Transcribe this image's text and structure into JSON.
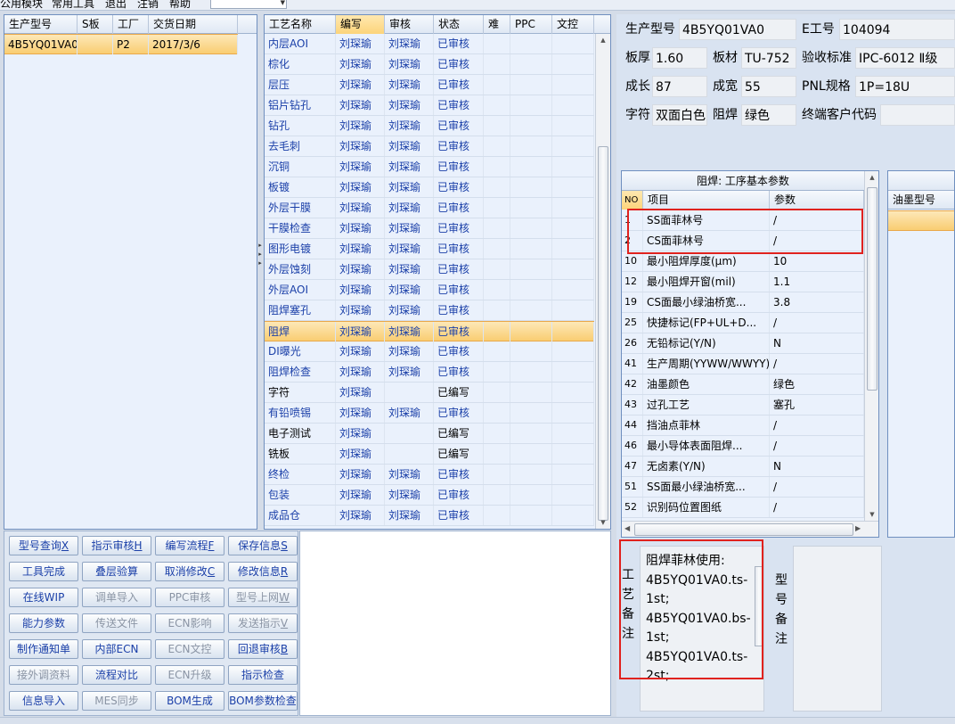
{
  "menu": {
    "items": [
      "公用模块",
      "常用工具",
      "退出",
      "注销",
      "帮助"
    ]
  },
  "model_grid": {
    "columns": [
      "生产型号",
      "S板",
      "工厂",
      "交货日期"
    ],
    "rows": [
      {
        "model": "4B5YQ01VA0",
        "s": "",
        "factory": "P2",
        "date": "2017/3/6"
      }
    ]
  },
  "process_grid": {
    "columns": [
      "工艺名称",
      "编写",
      "审核",
      "状态",
      "难",
      "PPC",
      "文控"
    ],
    "rows": [
      {
        "name": "内层AOI",
        "writer": "刘琛瑜",
        "reviewer": "刘琛瑜",
        "status": "已审核"
      },
      {
        "name": "棕化",
        "writer": "刘琛瑜",
        "reviewer": "刘琛瑜",
        "status": "已审核"
      },
      {
        "name": "层压",
        "writer": "刘琛瑜",
        "reviewer": "刘琛瑜",
        "status": "已审核"
      },
      {
        "name": "铝片钻孔",
        "writer": "刘琛瑜",
        "reviewer": "刘琛瑜",
        "status": "已审核"
      },
      {
        "name": "钻孔",
        "writer": "刘琛瑜",
        "reviewer": "刘琛瑜",
        "status": "已审核"
      },
      {
        "name": "去毛刺",
        "writer": "刘琛瑜",
        "reviewer": "刘琛瑜",
        "status": "已审核"
      },
      {
        "name": "沉铜",
        "writer": "刘琛瑜",
        "reviewer": "刘琛瑜",
        "status": "已审核"
      },
      {
        "name": "板镀",
        "writer": "刘琛瑜",
        "reviewer": "刘琛瑜",
        "status": "已审核"
      },
      {
        "name": "外层干膜",
        "writer": "刘琛瑜",
        "reviewer": "刘琛瑜",
        "status": "已审核"
      },
      {
        "name": "干膜检查",
        "writer": "刘琛瑜",
        "reviewer": "刘琛瑜",
        "status": "已审核"
      },
      {
        "name": "图形电镀",
        "writer": "刘琛瑜",
        "reviewer": "刘琛瑜",
        "status": "已审核"
      },
      {
        "name": "外层蚀刻",
        "writer": "刘琛瑜",
        "reviewer": "刘琛瑜",
        "status": "已审核"
      },
      {
        "name": "外层AOI",
        "writer": "刘琛瑜",
        "reviewer": "刘琛瑜",
        "status": "已审核"
      },
      {
        "name": "阻焊塞孔",
        "writer": "刘琛瑜",
        "reviewer": "刘琛瑜",
        "status": "已审核"
      },
      {
        "name": "阻焊",
        "writer": "刘琛瑜",
        "reviewer": "刘琛瑜",
        "status": "已审核"
      },
      {
        "name": "DI曝光",
        "writer": "刘琛瑜",
        "reviewer": "刘琛瑜",
        "status": "已审核"
      },
      {
        "name": "阻焊检查",
        "writer": "刘琛瑜",
        "reviewer": "刘琛瑜",
        "status": "已审核"
      },
      {
        "name": "字符",
        "writer": "刘琛瑜",
        "reviewer": "",
        "status": "已编写"
      },
      {
        "name": "有铅喷锡",
        "writer": "刘琛瑜",
        "reviewer": "刘琛瑜",
        "status": "已审核"
      },
      {
        "name": "电子测试",
        "writer": "刘琛瑜",
        "reviewer": "",
        "status": "已编写"
      },
      {
        "name": "铣板",
        "writer": "刘琛瑜",
        "reviewer": "",
        "status": "已编写"
      },
      {
        "name": "终检",
        "writer": "刘琛瑜",
        "reviewer": "刘琛瑜",
        "status": "已审核"
      },
      {
        "name": "包装",
        "writer": "刘琛瑜",
        "reviewer": "刘琛瑜",
        "status": "已审核"
      },
      {
        "name": "成品仓",
        "writer": "刘琛瑜",
        "reviewer": "刘琛瑜",
        "status": "已审核"
      }
    ]
  },
  "buttons": [
    {
      "label": "型号查询",
      "key": "X",
      "enabled": true
    },
    {
      "label": "指示审核",
      "key": "H",
      "enabled": true
    },
    {
      "label": "编写流程",
      "key": "F",
      "enabled": true
    },
    {
      "label": "保存信息",
      "key": "S",
      "enabled": true
    },
    {
      "label": "工具完成",
      "key": "",
      "enabled": true
    },
    {
      "label": "叠层验算",
      "key": "",
      "enabled": true
    },
    {
      "label": "取消修改",
      "key": "C",
      "enabled": true
    },
    {
      "label": "修改信息",
      "key": "R",
      "enabled": true
    },
    {
      "label": "在线WIP",
      "key": "",
      "enabled": true
    },
    {
      "label": "调单导入",
      "key": "",
      "enabled": false
    },
    {
      "label": "PPC审核",
      "key": "",
      "enabled": false
    },
    {
      "label": "型号上网",
      "key": "W",
      "enabled": false
    },
    {
      "label": "能力参数",
      "key": "",
      "enabled": true
    },
    {
      "label": "传送文件",
      "key": "",
      "enabled": false
    },
    {
      "label": "ECN影响",
      "key": "",
      "enabled": false
    },
    {
      "label": "发送指示",
      "key": "V",
      "enabled": false
    },
    {
      "label": "制作通知单",
      "key": "",
      "enabled": true
    },
    {
      "label": "内部ECN",
      "key": "",
      "enabled": true
    },
    {
      "label": "ECN文控",
      "key": "",
      "enabled": false
    },
    {
      "label": "回退审核",
      "key": "B",
      "enabled": true
    },
    {
      "label": "接外调资料",
      "key": "",
      "enabled": false
    },
    {
      "label": "流程对比",
      "key": "",
      "enabled": true
    },
    {
      "label": "ECN升级",
      "key": "",
      "enabled": false
    },
    {
      "label": "指示检查",
      "key": "",
      "enabled": true
    },
    {
      "label": "信息导入",
      "key": "",
      "enabled": true
    },
    {
      "label": "MES同步",
      "key": "",
      "enabled": false
    },
    {
      "label": "BOM生成",
      "key": "",
      "enabled": true
    },
    {
      "label": "BOM参数检查",
      "key": "",
      "enabled": true
    }
  ],
  "info": {
    "model_label": "生产型号",
    "model": "4B5YQ01VA0",
    "eng_label": "E工号",
    "eng": "104094",
    "thickness_label": "板厚",
    "thickness": "1.60",
    "material_label": "板材",
    "material": "TU-752",
    "std_label": "验收标准",
    "std": "IPC-6012 Ⅱ级",
    "len_label": "成长",
    "len": "87",
    "width_label": "成宽",
    "width": "55",
    "pnl_label": "PNL规格",
    "pnl": "1P=18U",
    "char_label": "字符",
    "char": "双面白色",
    "mask_label": "阻焊",
    "mask": "绿色",
    "cust_label": "终端客户代码",
    "cust": ""
  },
  "params_grid": {
    "title": "阻焊: 工序基本参数",
    "columns": [
      "NO",
      "项目",
      "参数"
    ],
    "rows": [
      {
        "no": "1",
        "item": "SS面菲林号",
        "value": "/"
      },
      {
        "no": "2",
        "item": "CS面菲林号",
        "value": "/"
      },
      {
        "no": "10",
        "item": "最小阻焊厚度(μm)",
        "value": "10"
      },
      {
        "no": "12",
        "item": "最小阻焊开窗(mil)",
        "value": "1.1"
      },
      {
        "no": "19",
        "item": "CS面最小绿油桥宽...",
        "value": "3.8"
      },
      {
        "no": "25",
        "item": "快捷标记(FP+UL+D...",
        "value": "/"
      },
      {
        "no": "26",
        "item": "无铅标记(Y/N)",
        "value": "N"
      },
      {
        "no": "41",
        "item": "生产周期(YYWW/WWYY)",
        "value": "/"
      },
      {
        "no": "42",
        "item": "油墨颜色",
        "value": "绿色"
      },
      {
        "no": "43",
        "item": "过孔工艺",
        "value": "塞孔"
      },
      {
        "no": "44",
        "item": "挡油点菲林",
        "value": "/"
      },
      {
        "no": "46",
        "item": "最小导体表面阻焊...",
        "value": "/"
      },
      {
        "no": "47",
        "item": "无卤素(Y/N)",
        "value": "N"
      },
      {
        "no": "51",
        "item": "SS面最小绿油桥宽...",
        "value": "/"
      },
      {
        "no": "52",
        "item": "识别码位置图纸",
        "value": "/"
      }
    ]
  },
  "ink_grid": {
    "columns": [
      "油墨型号"
    ]
  },
  "remark": {
    "label_chars": [
      "工",
      "艺",
      "备",
      "注"
    ],
    "lines": [
      "阻焊菲林使用:",
      "4B5YQ01VA0.ts-",
      "1st;",
      "4B5YQ01VA0.bs-",
      "1st;",
      "4B5YQ01VA0.ts-",
      "2st;"
    ],
    "model_label_chars": [
      "型",
      "号",
      "备",
      "注"
    ]
  },
  "colors": {
    "accent": "#f9cd72",
    "border": "#6f8fbf",
    "annotation": "#e0221e"
  }
}
